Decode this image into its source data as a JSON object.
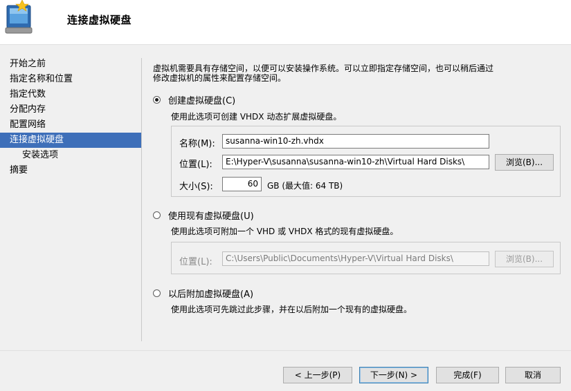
{
  "header": {
    "title": "连接虚拟硬盘",
    "icon": "virtual-disk-wizard-icon"
  },
  "nav": {
    "items": [
      {
        "label": "开始之前",
        "active": false,
        "sub": false
      },
      {
        "label": "指定名称和位置",
        "active": false,
        "sub": false
      },
      {
        "label": "指定代数",
        "active": false,
        "sub": false
      },
      {
        "label": "分配内存",
        "active": false,
        "sub": false
      },
      {
        "label": "配置网络",
        "active": false,
        "sub": false
      },
      {
        "label": "连接虚拟硬盘",
        "active": true,
        "sub": false
      },
      {
        "label": "安装选项",
        "active": false,
        "sub": true
      },
      {
        "label": "摘要",
        "active": false,
        "sub": false
      }
    ]
  },
  "content": {
    "description_line1": "虚拟机需要具有存储空间，以便可以安装操作系统。可以立即指定存储空间，也可以稍后通过",
    "description_line2": "修改虚拟机的属性来配置存储空间。",
    "option_create": {
      "label": "创建虚拟硬盘(C)",
      "checked": true,
      "description": "使用此选项可创建 VHDX 动态扩展虚拟硬盘。",
      "name_label": "名称(M):",
      "name_value": "susanna-win10-zh.vhdx",
      "location_label": "位置(L):",
      "location_value": "E:\\Hyper-V\\susanna\\susanna-win10-zh\\Virtual Hard Disks\\",
      "browse_label": "浏览(B)...",
      "size_label": "大小(S):",
      "size_value": "60",
      "size_unit": "GB (最大值: 64 TB)"
    },
    "option_existing": {
      "label": "使用现有虚拟硬盘(U)",
      "checked": false,
      "description": "使用此选项可附加一个 VHD 或 VHDX 格式的现有虚拟硬盘。",
      "location_label": "位置(L):",
      "location_value": "C:\\Users\\Public\\Documents\\Hyper-V\\Virtual Hard Disks\\",
      "browse_label": "浏览(B)..."
    },
    "option_later": {
      "label": "以后附加虚拟硬盘(A)",
      "checked": false,
      "description": "使用此选项可先跳过此步骤，并在以后附加一个现有的虚拟硬盘。"
    }
  },
  "footer": {
    "prev_label": "< 上一步(P)",
    "next_label": "下一步(N) >",
    "finish_label": "完成(F)",
    "cancel_label": "取消"
  },
  "colors": {
    "nav_active_bg": "#3e6fb9",
    "dialog_bg": "#f0f0f0"
  }
}
